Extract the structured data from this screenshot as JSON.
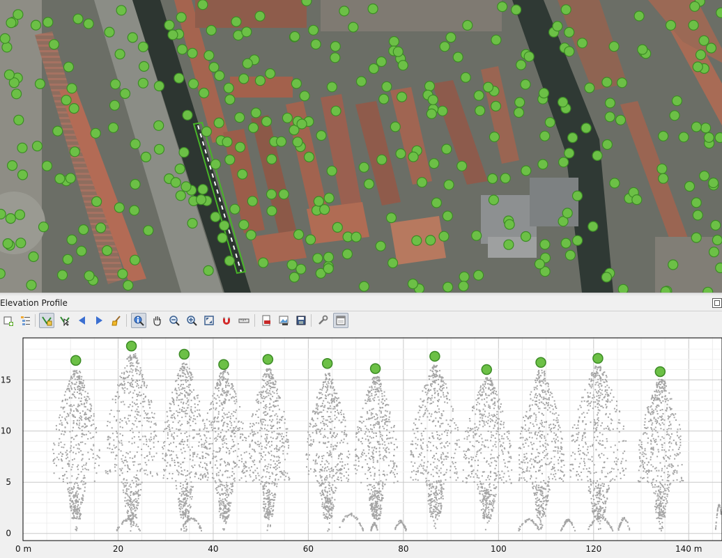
{
  "panel": {
    "title": "Elevation Profile"
  },
  "toolbar": {
    "buttons": [
      {
        "name": "add-layers-icon",
        "tooltip": "Add layers"
      },
      {
        "name": "layer-tree-icon",
        "tooltip": "Layer tree"
      },
      {
        "name": "capture-curve-icon",
        "tooltip": "Capture curve",
        "checked": true
      },
      {
        "name": "capture-from-feature-icon",
        "tooltip": "Capture curve from feature"
      },
      {
        "name": "nudge-left-icon",
        "tooltip": "Nudge left"
      },
      {
        "name": "nudge-right-icon",
        "tooltip": "Nudge right"
      },
      {
        "name": "clear-icon",
        "tooltip": "Clear"
      },
      {
        "name": "identify-icon",
        "tooltip": "Identify",
        "checked": true
      },
      {
        "name": "pan-icon",
        "tooltip": "Pan"
      },
      {
        "name": "zoom-x-icon",
        "tooltip": "Zoom X axis"
      },
      {
        "name": "zoom-in-icon",
        "tooltip": "Zoom in"
      },
      {
        "name": "zoom-full-icon",
        "tooltip": "Zoom full"
      },
      {
        "name": "snap-icon",
        "tooltip": "Snap"
      },
      {
        "name": "measure-icon",
        "tooltip": "Measure"
      },
      {
        "name": "export-pdf-icon",
        "tooltip": "Export to PDF"
      },
      {
        "name": "export-image-icon",
        "tooltip": "Export image"
      },
      {
        "name": "export-3d-icon",
        "tooltip": "Export 3D"
      },
      {
        "name": "options-icon",
        "tooltip": "Options"
      },
      {
        "name": "dock-icon",
        "tooltip": "Dock",
        "checked": true
      }
    ]
  },
  "colors": {
    "tree_marker": "#6cc046",
    "tree_marker_outline": "#3c8b25",
    "point_cloud": "#a5a5a5",
    "profile_line": "#47b527"
  },
  "chart_data": {
    "type": "scatter",
    "x_tick_labels": [
      "0 m",
      "20",
      "40",
      "60",
      "80",
      "100",
      "120",
      "140 m"
    ],
    "y_tick_labels": [
      "0",
      "5",
      "10",
      "15"
    ],
    "x_ticks": [
      0,
      20,
      40,
      60,
      80,
      100,
      120,
      140
    ],
    "y_ticks": [
      0,
      5,
      10,
      15
    ],
    "xlim": [
      0,
      147
    ],
    "ylim": [
      -0.7,
      19.1
    ],
    "grid": true,
    "series": [
      {
        "points": [
          {
            "x": 11.1,
            "y": 16.9
          },
          {
            "x": 22.8,
            "y": 18.3
          },
          {
            "x": 33.9,
            "y": 17.5
          },
          {
            "x": 42.2,
            "y": 16.5
          },
          {
            "x": 51.5,
            "y": 17.0
          },
          {
            "x": 64.0,
            "y": 16.6
          },
          {
            "x": 74.1,
            "y": 16.1
          },
          {
            "x": 86.6,
            "y": 17.3
          },
          {
            "x": 97.5,
            "y": 16.0
          },
          {
            "x": 108.9,
            "y": 16.7
          },
          {
            "x": 120.9,
            "y": 17.1
          },
          {
            "x": 134.0,
            "y": 15.8
          }
        ]
      }
    ],
    "tree_crowns": [
      {
        "x": 11.1,
        "top": 16.0,
        "width": 5.0
      },
      {
        "x": 22.8,
        "top": 17.6,
        "width": 5.6
      },
      {
        "x": 33.9,
        "top": 16.7,
        "width": 4.8
      },
      {
        "x": 42.2,
        "top": 16.0,
        "width": 4.8
      },
      {
        "x": 51.5,
        "top": 16.2,
        "width": 4.4
      },
      {
        "x": 64.0,
        "top": 15.7,
        "width": 4.6
      },
      {
        "x": 74.1,
        "top": 15.4,
        "width": 4.6
      },
      {
        "x": 86.6,
        "top": 16.5,
        "width": 5.2
      },
      {
        "x": 97.5,
        "top": 15.3,
        "width": 5.2
      },
      {
        "x": 108.9,
        "top": 16.0,
        "width": 4.8
      },
      {
        "x": 120.9,
        "top": 16.4,
        "width": 6.0
      },
      {
        "x": 134.0,
        "top": 15.2,
        "width": 4.8
      }
    ],
    "ground_clusters": [
      {
        "x0": 19.5,
        "x1": 24.5,
        "y": 1.1
      },
      {
        "x0": 33.0,
        "x1": 37.5,
        "y": 1.2
      },
      {
        "x0": 66.0,
        "x1": 71.5,
        "y": 1.6
      },
      {
        "x0": 73.0,
        "x1": 74.5,
        "y": 0.7
      },
      {
        "x0": 78.0,
        "x1": 80.5,
        "y": 0.9
      },
      {
        "x0": 104.0,
        "x1": 108.5,
        "y": 1.1
      },
      {
        "x0": 113.0,
        "x1": 116.0,
        "y": 1.0
      },
      {
        "x0": 118.5,
        "x1": 124.0,
        "y": 1.3
      },
      {
        "x0": 125.0,
        "x1": 127.5,
        "y": 1.2
      },
      {
        "x0": 145.5,
        "x1": 147.0,
        "y": 2.5
      }
    ]
  }
}
